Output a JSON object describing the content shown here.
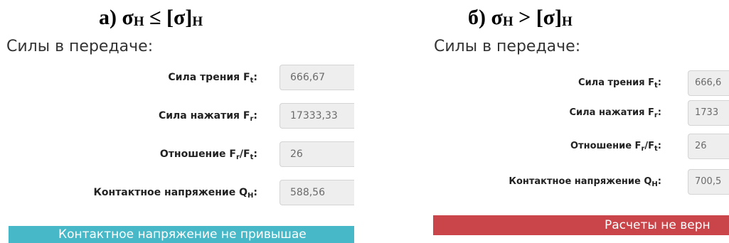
{
  "left": {
    "heading_main": "а) σ",
    "heading_sub": "H",
    "heading_relation": " ≤ [σ]",
    "heading_sub2": "H",
    "section_title": "Силы в передаче:",
    "rows": [
      {
        "label": "Сила трения F",
        "label_sub": "t",
        "suffix": ":",
        "value": "666,67"
      },
      {
        "label": "Сила нажатия F",
        "label_sub": "r",
        "suffix": ":",
        "value": "17333,33"
      },
      {
        "label": "Отношение F",
        "label_sub": "r",
        "mid": "/F",
        "label_sub2": "t",
        "suffix": ":",
        "value": "26"
      },
      {
        "label": "Контактное напряжение Q",
        "label_sub": "H",
        "suffix": ":",
        "value": "588,56"
      }
    ],
    "alert": "Контактное напряжение не привышае"
  },
  "right": {
    "heading_main": "б) σ",
    "heading_sub": "H",
    "heading_relation": " > [σ]",
    "heading_sub2": "H",
    "section_title": "Силы в передаче:",
    "rows": [
      {
        "label": "Сила трения F",
        "label_sub": "t",
        "suffix": ":",
        "value": "666,6"
      },
      {
        "label": "Сила нажатия F",
        "label_sub": "r",
        "suffix": ":",
        "value": "1733"
      },
      {
        "label": "Отношение F",
        "label_sub": "r",
        "mid": "/F",
        "label_sub2": "t",
        "suffix": ":",
        "value": "26"
      },
      {
        "label": "Контактное напряжение Q",
        "label_sub": "H",
        "suffix": ":",
        "value": "700,5"
      }
    ],
    "alert": "Расчеты не верн"
  },
  "colors": {
    "info_alert": "#46b8c7",
    "danger_alert": "#c9454a",
    "field_bg": "#eeeeee"
  }
}
